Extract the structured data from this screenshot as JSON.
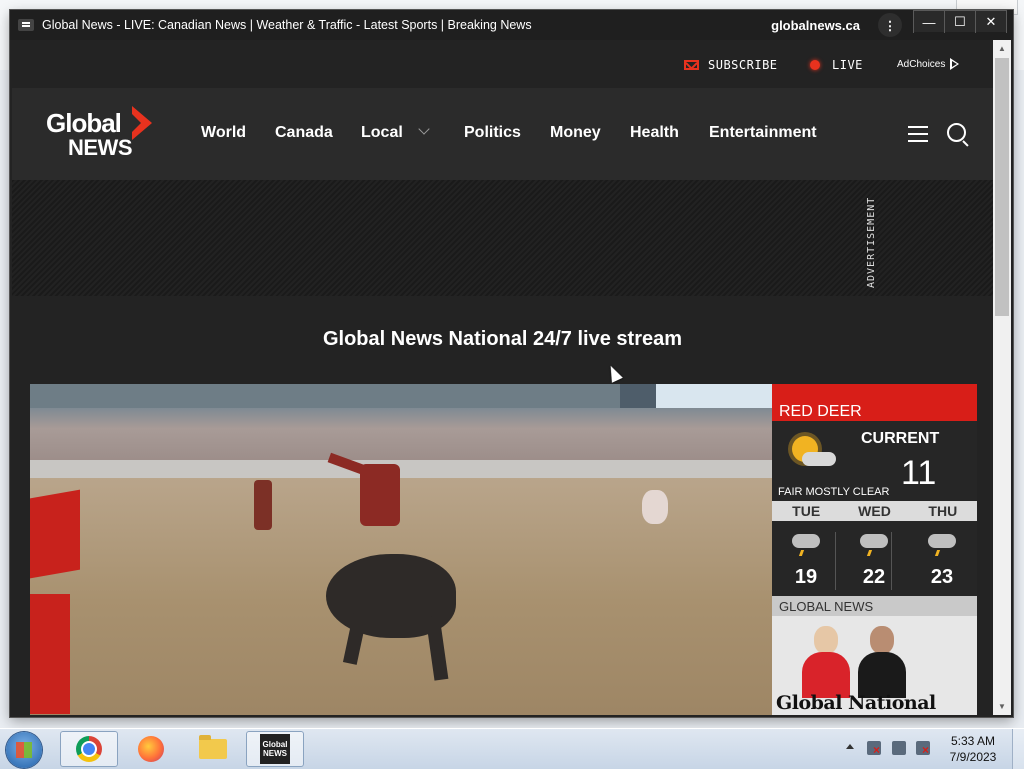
{
  "window": {
    "title": "Global News - LIVE: Canadian News | Weather & Traffic - Latest Sports | Breaking News",
    "domain": "globalnews.ca",
    "menu_glyph": "⋮",
    "min_glyph": "—",
    "max_glyph": "☐",
    "close_glyph": "✕"
  },
  "scrollbar": {
    "up_glyph": "▲",
    "down_glyph": "▼"
  },
  "utility": {
    "subscribe": "SUBSCRIBE",
    "live": "LIVE",
    "adchoices": "AdChoices"
  },
  "nav": {
    "logo_line1": "Global",
    "logo_line2": "NEWS",
    "links": [
      "World",
      "Canada",
      "Local",
      "Politics",
      "Money",
      "Health",
      "Entertainment"
    ]
  },
  "ad": {
    "label": "ADVERTISEMENT"
  },
  "stream": {
    "title": "Global News National 24/7 live stream"
  },
  "weather": {
    "city": "RED DEER",
    "current_label": "CURRENT",
    "current_temp": "11",
    "condition": "FAIR MOSTLY CLEAR",
    "forecast": [
      {
        "day": "TUE",
        "temp": "19"
      },
      {
        "day": "WED",
        "temp": "22"
      },
      {
        "day": "THU",
        "temp": "23"
      }
    ],
    "brand": "GLOBAL NEWS",
    "promo_title": "Global National"
  },
  "taskbar": {
    "gn_icon_text": "Global NEWS",
    "time": "5:33 AM",
    "date": "7/9/2023"
  },
  "colors": {
    "accent_red": "#e8321e",
    "nav_bg": "#2b2b2b",
    "page_bg": "#232323"
  }
}
